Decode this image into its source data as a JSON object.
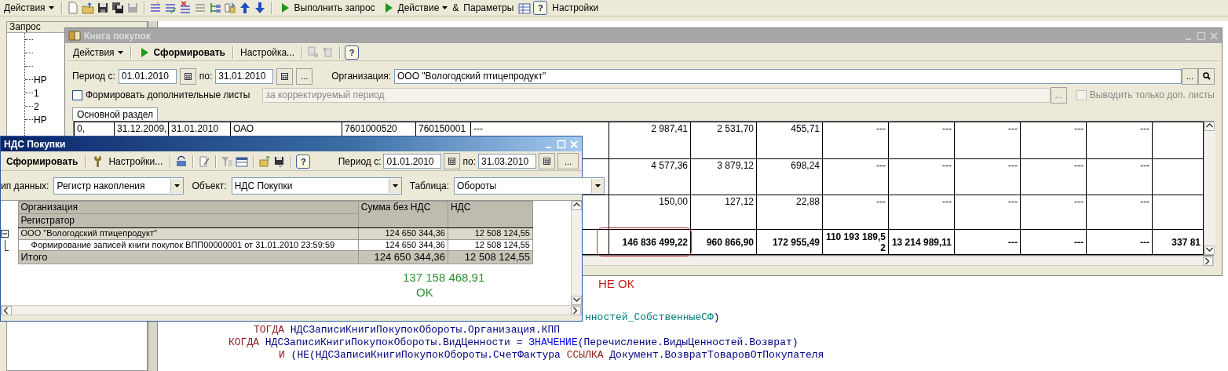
{
  "main_toolbar": {
    "actions_menu": "Действия",
    "run_query": "Выполнить запрос",
    "action_menu": "Действие",
    "parameters_glyph": "&",
    "parameters": "Параметры",
    "help": "?",
    "settings": "Настройки"
  },
  "query_panel": {
    "title": "Запрос",
    "tree": [
      {
        "kind": "stub"
      },
      {
        "kind": "stub"
      },
      {
        "kind": "stub"
      },
      {
        "kind": "leaf",
        "label": "НР"
      },
      {
        "kind": "leaf",
        "label": "1"
      },
      {
        "kind": "leaf",
        "label": "2"
      },
      {
        "kind": "leaf",
        "label": "НР"
      }
    ]
  },
  "code_lines": [
    [
      {
        "kind": "param",
        "text": "нностей_СобственныеСФ"
      },
      {
        "kind": "ident",
        "text": ")"
      }
    ],
    [
      {
        "kind": "keyword",
        "text": "ТОГДА"
      },
      {
        "kind": "ident",
        "text": " НДСЗаписиКнигиПокупокОбороты.Организация.КПП"
      }
    ],
    [
      {
        "kind": "keyword",
        "text": "КОГДА"
      },
      {
        "kind": "ident",
        "text": " НДСЗаписиКнигиПокупокОбороты.ВидЦенности = "
      },
      {
        "kind": "func",
        "text": "ЗНАЧЕНИЕ"
      },
      {
        "kind": "ident",
        "text": "(Перечисление.ВидыЦенностей.Возврат)"
      }
    ],
    [
      {
        "kind": "keyword",
        "text": "И"
      },
      {
        "kind": "ident",
        "text": " (НЕ(НДСЗаписиКнигиПокупокОбороты.СчетФактура "
      },
      {
        "kind": "keyword",
        "text": "ССЫЛКА"
      },
      {
        "kind": "ident",
        "text": " Документ.ВозвратТоваровОтПокупателя"
      }
    ]
  ],
  "book_window": {
    "title": "Книга покупок",
    "active": false,
    "toolbar": {
      "actions_menu": "Действия",
      "generate": "Сформировать",
      "settings": "Настройка...",
      "help": "?"
    },
    "period_label": "Период с:",
    "period_from": "01.01.2010",
    "period_to_label": "по:",
    "period_to": "31.01.2010",
    "more": "...",
    "organization_label": "Организация:",
    "organization": "ООО \"Вологодский птицепродукт\"",
    "organization_more": "...",
    "extra_sheets": {
      "label": "Формировать дополнительные листы",
      "checked": false
    },
    "correction_period": {
      "value": "за корректируемый период",
      "disabled": true,
      "more": "..."
    },
    "only_extra": {
      "label": "Выводить только доп. листы",
      "checked": false,
      "disabled": true
    },
    "tabs": [
      {
        "label": "Основной раздел",
        "selected": true
      }
    ],
    "table": {
      "total_circled": true,
      "rows": [
        {
          "kind": "entry",
          "lead_cells": [
            "0,",
            "31.12.2009,",
            "31.01.2010",
            "ОАО",
            "7601000520",
            "760150001",
            "---"
          ],
          "cells": [
            "2 987,41",
            "2 531,70",
            "455,71",
            "---",
            "---",
            "---",
            "---",
            "---"
          ]
        },
        {
          "kind": "entry",
          "cells": [
            "4 577,36",
            "3 879,12",
            "698,24",
            "---",
            "---",
            "---",
            "---",
            "---"
          ]
        },
        {
          "kind": "entry",
          "cells": [
            "150,00",
            "127,12",
            "22,88",
            "---",
            "---",
            "---",
            "---",
            "---"
          ]
        },
        {
          "kind": "total",
          "cells": [
            "146 836 499,22",
            "960 866,90",
            "172 955,49",
            "110 193 189,52",
            "13 214 989,11",
            "---",
            "---",
            "---",
            "337 81"
          ]
        }
      ]
    }
  },
  "vat_window": {
    "title": "НДС Покупки",
    "active": true,
    "toolbar": {
      "generate": "Сформировать",
      "settings": "Настройки...",
      "help": "?"
    },
    "period_label": "Период с:",
    "period_from": "01.01.2010",
    "period_to_label": "по:",
    "period_to": "31.03.2010",
    "more": "...",
    "data_type_label": "ип данных:",
    "data_type": "Регистр накопления",
    "object_label": "Объект:",
    "object": "НДС Покупки",
    "table_label": "Таблица:",
    "table_value": "Обороты",
    "grid": {
      "columns": {
        "group": "Организация",
        "detail": "Регистратор",
        "amount": "Сумма без НДС",
        "vat": "НДС"
      },
      "rows": [
        {
          "kind": "group",
          "expanded": true,
          "name": "ООО \"Вологодский птицепродукт\"",
          "amount": "124 650 344,36",
          "vat": "12 508 124,55",
          "children": [
            {
              "kind": "detail",
              "name": "Формирование записей книги покупок ВПП00000001 от 31.01.2010 23:59:59",
              "amount": "124 650 344,36",
              "vat": "12 508 124,55"
            }
          ]
        }
      ],
      "total": {
        "label": "Итого",
        "amount": "124 650 344,36",
        "vat": "12 508 124,55"
      }
    }
  },
  "notes": [
    {
      "text": "137 158 468,91",
      "color": "#2f8f2f"
    },
    {
      "text": "OK",
      "color": "#2f8f2f"
    },
    {
      "text": "НЕ ОК",
      "color": "#c42020"
    }
  ]
}
